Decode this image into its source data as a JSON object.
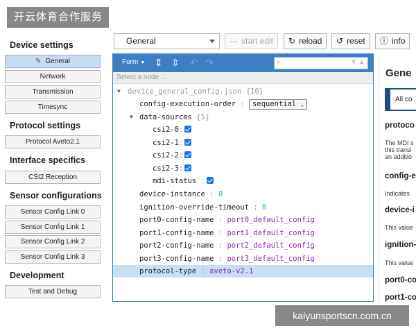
{
  "watermark": {
    "top": "开云体育合作服务",
    "bottom": "kaiyunsportscn.com.cn"
  },
  "sidebar": {
    "device_settings": {
      "heading": "Device settings",
      "items": [
        {
          "label": "General",
          "active": true
        },
        {
          "label": "Network"
        },
        {
          "label": "Transmission"
        },
        {
          "label": "Timesync"
        }
      ]
    },
    "protocol_settings": {
      "heading": "Protocol settings",
      "items": [
        {
          "label": "Protocol Aveto2.1"
        }
      ]
    },
    "interface_specifics": {
      "heading": "Interface specifics",
      "items": [
        {
          "label": "CSI2 Reception"
        }
      ]
    },
    "sensor_configurations": {
      "heading": "Sensor configurations",
      "items": [
        {
          "label": "Sensor Config Link 0"
        },
        {
          "label": "Sensor Config Link 1"
        },
        {
          "label": "Sensor Config Link 2"
        },
        {
          "label": "Sensor Config Link 3"
        }
      ]
    },
    "development": {
      "heading": "Development",
      "items": [
        {
          "label": "Test and Debug"
        }
      ]
    }
  },
  "toolbar": {
    "config_select": "General",
    "start_edit": "start edit",
    "reload": "reload",
    "reset": "reset",
    "info": "info"
  },
  "editor": {
    "mode": "Form",
    "search_placeholder": "",
    "node_path_placeholder": "Select a node ...",
    "tree": {
      "root": {
        "key": "device_general_config.json",
        "count": "{10}"
      },
      "config_execution_order": {
        "key": "config-execution-order",
        "value": "sequential"
      },
      "data_sources": {
        "key": "data-sources",
        "count": "{5}"
      },
      "csi2_0": {
        "key": "csi2-0",
        "checked": true
      },
      "csi2_1": {
        "key": "csi2-1",
        "checked": true
      },
      "csi2_2": {
        "key": "csi2-2",
        "checked": true
      },
      "csi2_3": {
        "key": "csi2-3",
        "checked": true
      },
      "mdi_status": {
        "key": "mdi-status",
        "checked": true
      },
      "device_instance": {
        "key": "device-instance",
        "value": "0"
      },
      "ignition_override_timeout": {
        "key": "ignition-override-timeout",
        "value": "0"
      },
      "port0": {
        "key": "port0-config-name",
        "value": "port0_default_config"
      },
      "port1": {
        "key": "port1-config-name",
        "value": "port1_default_config"
      },
      "port2": {
        "key": "port2-config-name",
        "value": "port2_default_config"
      },
      "port3": {
        "key": "port3-config-name",
        "value": "port3_default_config"
      },
      "protocol_type": {
        "key": "protocol-type",
        "value": "aveto-v2.1"
      }
    },
    "separator": ":"
  },
  "doc": {
    "title": "Gene",
    "tab": "All co",
    "sections": [
      {
        "heading": "protoco",
        "lines": [
          "The MDI s",
          "this transi",
          "an additio"
        ]
      },
      {
        "heading": "config-e",
        "lines": [
          "Indicates"
        ]
      },
      {
        "heading": "device-i",
        "lines": [
          "This value"
        ]
      },
      {
        "heading": "ignition-",
        "lines": [
          "This value"
        ]
      },
      {
        "heading": "port0-co",
        "lines": []
      },
      {
        "heading": "port1-co",
        "lines": []
      }
    ]
  },
  "colors": {
    "accent": "#3c7fc4",
    "selected_row": "#c7def5",
    "number": "#2fb3a8",
    "string": "#8f2aa8",
    "checkbox": "#1a73e8"
  }
}
